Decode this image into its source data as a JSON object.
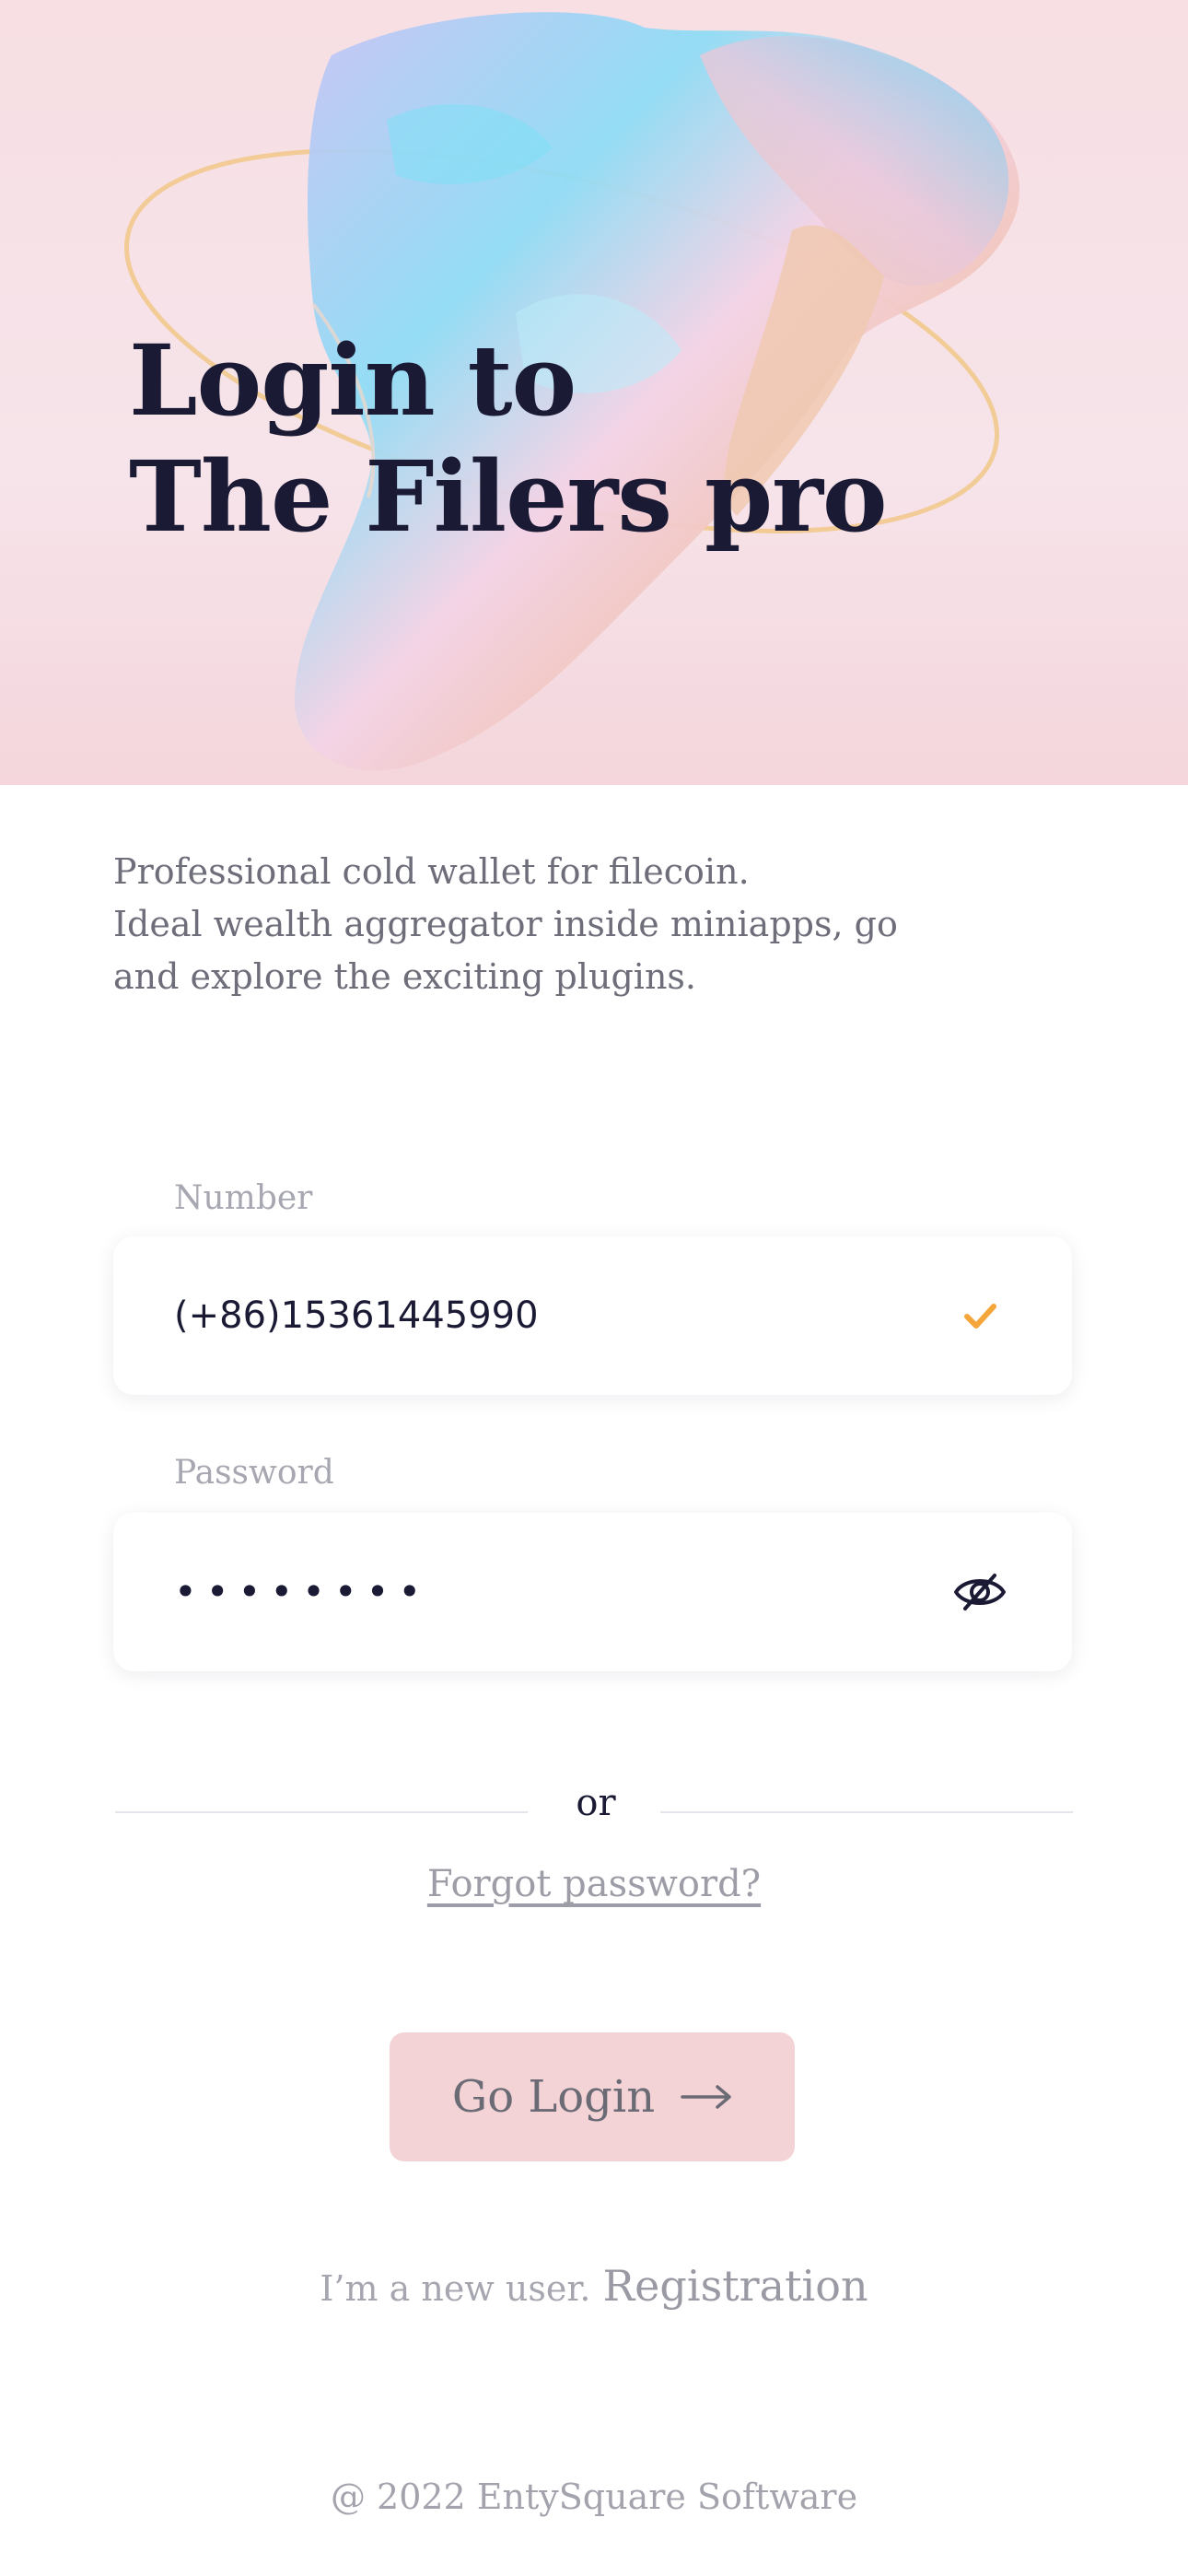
{
  "hero": {
    "title_line1": "Login to",
    "title_line2": "The Filers pro"
  },
  "description": {
    "line1": "Professional cold wallet for filecoin.",
    "line2": "Ideal wealth aggregator inside miniapps, go",
    "line3": "and explore the exciting plugins."
  },
  "form": {
    "number_label": "Number",
    "number_value": "(+86)15361445990",
    "number_status_icon": "check-icon",
    "password_label": "Password",
    "password_masked": "••••••••",
    "password_toggle_icon": "eye-off-icon"
  },
  "divider": {
    "or_label": "or"
  },
  "forgot_password": "Forgot password?",
  "login_button": {
    "label": "Go Login",
    "icon": "arrow-right-icon"
  },
  "register": {
    "prompt": "I’m a new user.",
    "link": "Registration"
  },
  "footer": "@ 2022 EntySquare Software",
  "colors": {
    "hero_bg": "#f7dfe3",
    "title": "#1a1a35",
    "accent_check": "#f5a63a",
    "button_bg": "#f4d3d6",
    "muted_text": "#a7a7b2"
  }
}
